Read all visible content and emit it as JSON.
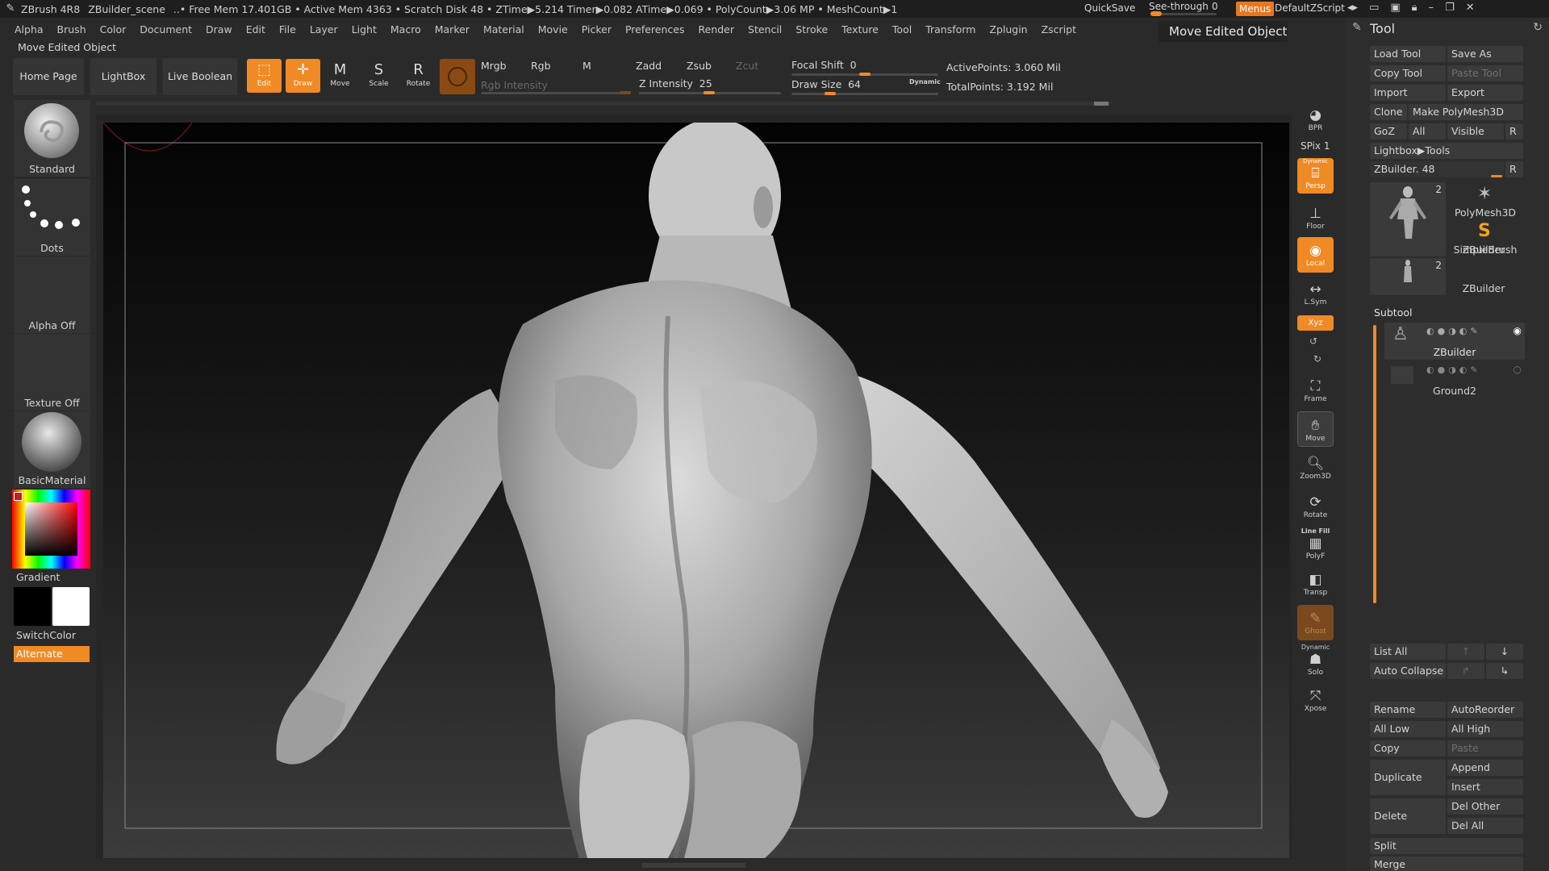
{
  "titlebar": {
    "app": "ZBrush 4R8",
    "scene": "ZBuilder_scene",
    "status": "..• Free Mem 17.401GB • Active Mem 4363 • Scratch Disk 48 • ZTime▶5.214 Timer▶0.082 ATime▶0.069 • PolyCount▶3.06 MP • MeshCount▶1",
    "quicksave": "QuickSave",
    "seethrough_label": "See-through",
    "seethrough_value": "0",
    "menus": "Menus",
    "defaultzscript": "DefaultZScript"
  },
  "menubar": [
    "Alpha",
    "Brush",
    "Color",
    "Document",
    "Draw",
    "Edit",
    "File",
    "Layer",
    "Light",
    "Macro",
    "Marker",
    "Material",
    "Movie",
    "Picker",
    "Preferences",
    "Render",
    "Stencil",
    "Stroke",
    "Texture",
    "Tool",
    "Transform",
    "Zplugin",
    "Zscript"
  ],
  "status_label": "Move Edited Object",
  "tooltip": "Move Edited Object",
  "shelf": {
    "home": "Home Page",
    "lightbox": "LightBox",
    "live_boolean": "Live Boolean",
    "edit": "Edit",
    "draw": "Draw",
    "move": "Move",
    "scale": "Scale",
    "rotate": "Rotate",
    "mrgb": "Mrgb",
    "rgb": "Rgb",
    "m": "M",
    "rgb_intensity": "Rgb Intensity",
    "zadd": "Zadd",
    "zsub": "Zsub",
    "zcut": "Zcut",
    "z_intensity_label": "Z Intensity",
    "z_intensity_value": "25",
    "focal_shift_label": "Focal Shift",
    "focal_shift_value": "0",
    "draw_size_label": "Draw Size",
    "draw_size_value": "64",
    "dynamic": "Dynamic",
    "active_points": "ActivePoints: 3.060 Mil",
    "total_points": "TotalPoints: 3.192 Mil"
  },
  "left_tray": {
    "brush": "Standard",
    "stroke": "Dots",
    "alpha": "Alpha Off",
    "texture": "Texture Off",
    "material": "BasicMaterial",
    "gradient": "Gradient",
    "switchcolor": "SwitchColor",
    "alternate": "Alternate"
  },
  "dock": {
    "bpr": "BPR",
    "spix": "SPix 1",
    "persp": "Persp",
    "dynamic_top": "Dynamic",
    "floor": "Floor",
    "local": "Local",
    "lsym": "L.Sym",
    "xyz": "Xyz",
    "frame": "Frame",
    "move": "Move",
    "zoom3d": "Zoom3D",
    "rotate": "Rotate",
    "line_fill": "Line Fill",
    "polyf": "PolyF",
    "transp": "Transp",
    "ghost": "Ghost",
    "dynamic_solo": "Dynamic",
    "solo": "Solo",
    "xpose": "Xpose"
  },
  "tool_palette": {
    "title": "Tool",
    "load_tool": "Load Tool",
    "save_as": "Save As",
    "copy_tool": "Copy Tool",
    "paste_tool": "Paste Tool",
    "import": "Import",
    "export": "Export",
    "clone": "Clone",
    "make_polymesh": "Make PolyMesh3D",
    "goz": "GoZ",
    "all": "All",
    "visible": "Visible",
    "r": "R",
    "lightbox_tools": "Lightbox▶Tools",
    "zbuilder_slider": "ZBuilder. 48",
    "thumbs": [
      {
        "label": "ZBuilder",
        "count": "2"
      },
      {
        "label": "PolyMesh3D"
      },
      {
        "label": "SimpleBrush"
      },
      {
        "label": "ZBuilder",
        "count": "2"
      }
    ],
    "subtool_header": "Subtool",
    "subtools": [
      "ZBuilder",
      "Ground2"
    ],
    "list_all": "List All",
    "auto_collapse": "Auto Collapse",
    "rename": "Rename",
    "autoreorder": "AutoReorder",
    "all_low": "All Low",
    "all_high": "All High",
    "copy": "Copy",
    "paste": "Paste",
    "duplicate": "Duplicate",
    "append": "Append",
    "insert": "Insert",
    "delete": "Delete",
    "del_other": "Del Other",
    "del_all": "Del All",
    "split": "Split",
    "merge": "Merge"
  },
  "colors": {
    "accent": "#f08a24",
    "panel": "#2d2d2d",
    "bg": "#2a2a2a"
  }
}
